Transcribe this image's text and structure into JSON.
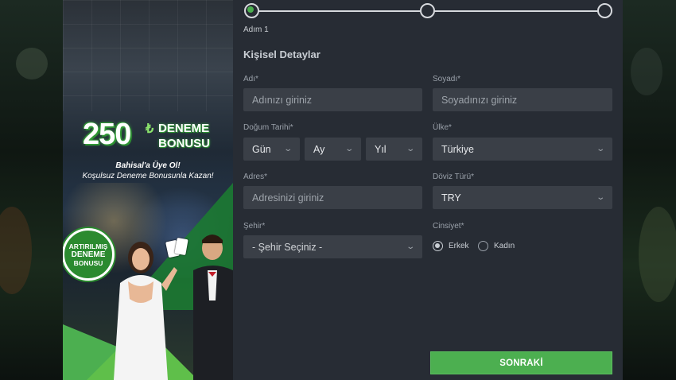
{
  "promo": {
    "amount": "250",
    "currency": "₺",
    "title": "DENEME BONUSU",
    "line1": "Bahisal'a Üye Ol!",
    "line2": "Koşulsuz Deneme Bonusunla Kazan!",
    "badge": [
      "ARTIRILMIŞ",
      "DENEME",
      "BONUSU"
    ]
  },
  "stepper": {
    "current_label": "Adım 1",
    "steps_total": 3,
    "current": 1
  },
  "form": {
    "section_title": "Kişisel Detaylar",
    "first_name": {
      "label": "Adı*",
      "placeholder": "Adınızı giriniz"
    },
    "last_name": {
      "label": "Soyadı*",
      "placeholder": "Soyadınızı giriniz"
    },
    "birth_date": {
      "label": "Doğum Tarihi*",
      "day": "Gün",
      "month": "Ay",
      "year": "Yıl"
    },
    "country": {
      "label": "Ülke*",
      "value": "Türkiye"
    },
    "address": {
      "label": "Adres*",
      "placeholder": "Adresinizi giriniz"
    },
    "currency": {
      "label": "Döviz Türü*",
      "value": "TRY"
    },
    "city": {
      "label": "Şehir*",
      "value": "- Şehir Seçiniz -"
    },
    "gender": {
      "label": "Cinsiyet*",
      "options": [
        "Erkek",
        "Kadın"
      ],
      "selected": "Erkek"
    },
    "next_button": "SONRAKİ"
  },
  "colors": {
    "accent": "#4caf50",
    "panel": "#272c34",
    "input": "#3a3f47"
  }
}
